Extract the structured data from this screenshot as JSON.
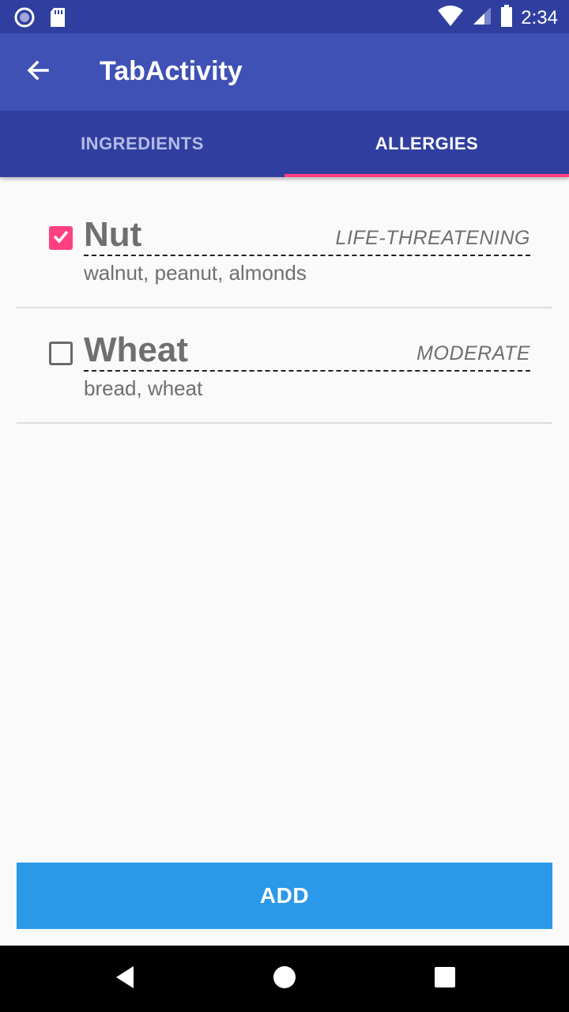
{
  "status_bar": {
    "time": "2:34",
    "icons": [
      "circle-notification-icon",
      "sd-card-icon",
      "wifi-icon",
      "cell-signal-icon",
      "battery-icon"
    ]
  },
  "app_bar": {
    "title": "TabActivity",
    "back_icon": "arrow-back-icon"
  },
  "tabs": [
    {
      "label": "INGREDIENTS",
      "selected": false
    },
    {
      "label": "ALLERGIES",
      "selected": true
    }
  ],
  "allergies": [
    {
      "name": "Nut",
      "severity": "LIFE-THREATENING",
      "items": "walnut, peanut, almonds",
      "checked": true
    },
    {
      "name": "Wheat",
      "severity": "MODERATE",
      "items": "bread, wheat",
      "checked": false
    }
  ],
  "add_button": {
    "label": "ADD"
  },
  "colors": {
    "status_bar": "#303f9f",
    "app_bar": "#3f51b5",
    "accent": "#ff4081",
    "button": "#2b99e9"
  },
  "nav_bar": {
    "icons": [
      "nav-back-icon",
      "nav-home-icon",
      "nav-recents-icon"
    ]
  }
}
